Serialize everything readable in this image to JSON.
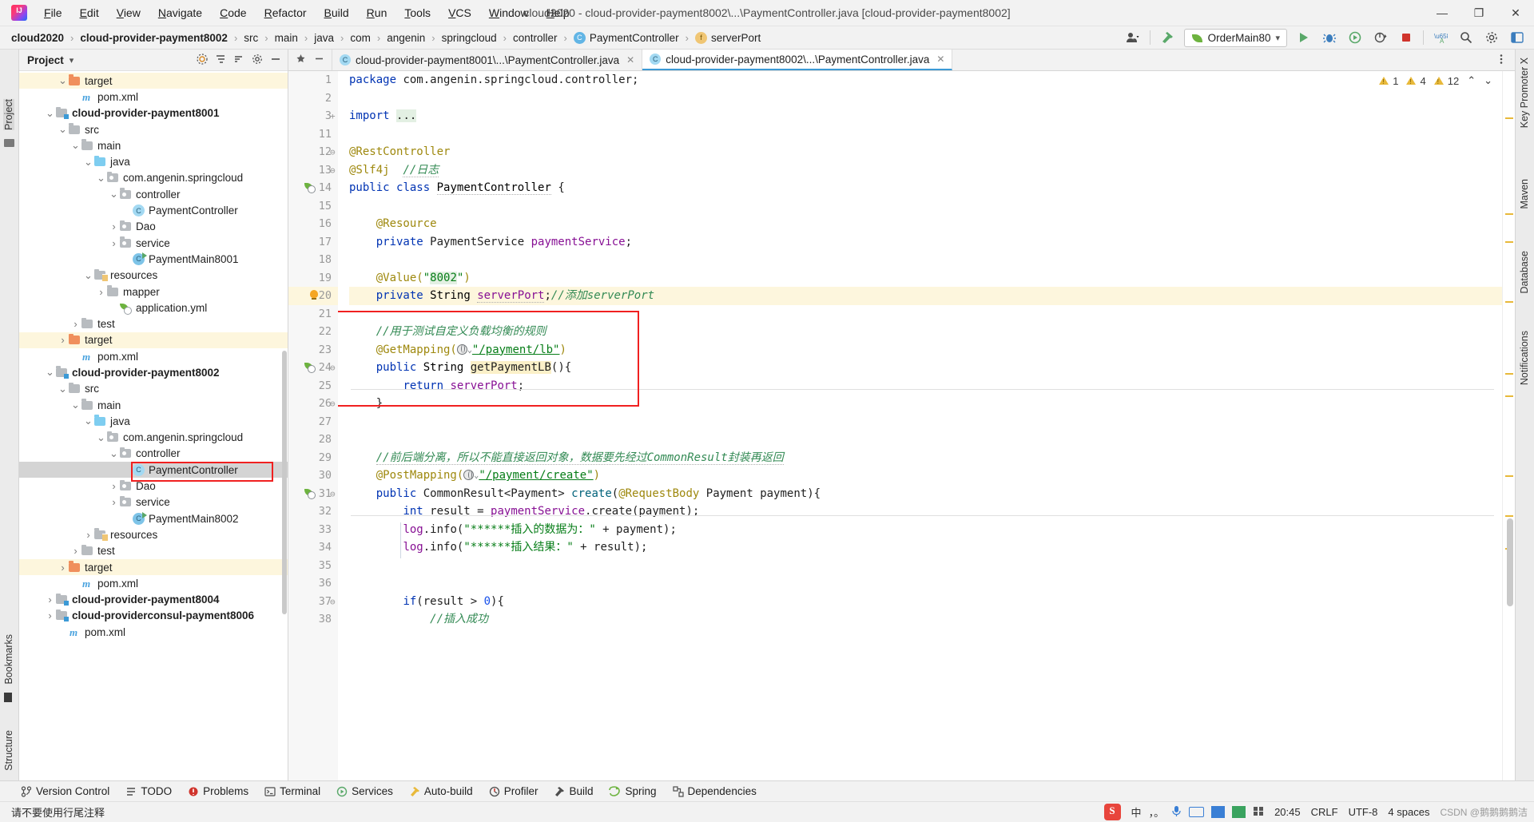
{
  "window": {
    "title": "cloud2020 - cloud-provider-payment8002\\...\\PaymentController.java [cloud-provider-payment8002]",
    "minimize": "—",
    "maximize": "❐",
    "close": "✕"
  },
  "menu": [
    "File",
    "Edit",
    "View",
    "Navigate",
    "Code",
    "Refactor",
    "Build",
    "Run",
    "Tools",
    "VCS",
    "Window",
    "Help"
  ],
  "breadcrumb": [
    {
      "label": "cloud2020",
      "bold": true,
      "icon": ""
    },
    {
      "label": "cloud-provider-payment8002",
      "bold": true,
      "icon": ""
    },
    {
      "label": "src",
      "bold": false,
      "icon": ""
    },
    {
      "label": "main",
      "bold": false,
      "icon": ""
    },
    {
      "label": "java",
      "bold": false,
      "icon": ""
    },
    {
      "label": "com",
      "bold": false,
      "icon": ""
    },
    {
      "label": "angenin",
      "bold": false,
      "icon": ""
    },
    {
      "label": "springcloud",
      "bold": false,
      "icon": ""
    },
    {
      "label": "controller",
      "bold": false,
      "icon": ""
    },
    {
      "label": "PaymentController",
      "bold": false,
      "icon": "class-icon",
      "glyph": "C"
    },
    {
      "label": "serverPort",
      "bold": false,
      "icon": "field-icon",
      "glyph": "f"
    }
  ],
  "toolbar": {
    "run_config": "OrderMain80",
    "run_config_dropdown": "▾",
    "icons": [
      "user-icon",
      "hammer-icon",
      "run-icon",
      "debug-icon",
      "run-coverage-icon",
      "profile-icon",
      "stop-icon",
      "translate-icon",
      "search-icon",
      "settings-icon",
      "layout-icon"
    ]
  },
  "project_panel": {
    "title": "Project",
    "dropdown": "▾",
    "header_buttons": [
      "locate-icon",
      "collapse-all-icon",
      "sort-icon",
      "settings-icon",
      "hide-icon"
    ],
    "tree": [
      {
        "label": "target",
        "indent": 3,
        "arrow": "v",
        "icon": "folder-orange",
        "bold": false,
        "highlight": "target",
        "partial": true
      },
      {
        "label": "pom.xml",
        "indent": 4,
        "arrow": "",
        "icon": "maven-icon",
        "bold": false
      },
      {
        "label": "cloud-provider-payment8001",
        "indent": 2,
        "arrow": "v",
        "icon": "module-icon",
        "bold": true
      },
      {
        "label": "src",
        "indent": 3,
        "arrow": "v",
        "icon": "folder",
        "bold": false
      },
      {
        "label": "main",
        "indent": 4,
        "arrow": "v",
        "icon": "folder",
        "bold": false
      },
      {
        "label": "java",
        "indent": 5,
        "arrow": "v",
        "icon": "folder-blue",
        "bold": false
      },
      {
        "label": "com.angenin.springcloud",
        "indent": 6,
        "arrow": "v",
        "icon": "package-icon",
        "bold": false
      },
      {
        "label": "controller",
        "indent": 7,
        "arrow": "v",
        "icon": "package-icon",
        "bold": false
      },
      {
        "label": "PaymentController",
        "indent": 8,
        "arrow": "",
        "icon": "class-icon",
        "bold": false
      },
      {
        "label": "Dao",
        "indent": 7,
        "arrow": ">",
        "icon": "package-icon",
        "bold": false
      },
      {
        "label": "service",
        "indent": 7,
        "arrow": ">",
        "icon": "package-icon",
        "bold": false
      },
      {
        "label": "PaymentMain8001",
        "indent": 8,
        "arrow": "",
        "icon": "class-run-icon",
        "bold": false
      },
      {
        "label": "resources",
        "indent": 5,
        "arrow": "v",
        "icon": "folder-resources",
        "bold": false
      },
      {
        "label": "mapper",
        "indent": 6,
        "arrow": ">",
        "icon": "folder",
        "bold": false
      },
      {
        "label": "application.yml",
        "indent": 7,
        "arrow": "",
        "icon": "spring-yml-icon",
        "bold": false
      },
      {
        "label": "test",
        "indent": 4,
        "arrow": ">",
        "icon": "folder",
        "bold": false
      },
      {
        "label": "target",
        "indent": 3,
        "arrow": ">",
        "icon": "folder-orange",
        "bold": false,
        "highlight": "target"
      },
      {
        "label": "pom.xml",
        "indent": 4,
        "arrow": "",
        "icon": "maven-icon",
        "bold": false
      },
      {
        "label": "cloud-provider-payment8002",
        "indent": 2,
        "arrow": "v",
        "icon": "module-icon",
        "bold": true
      },
      {
        "label": "src",
        "indent": 3,
        "arrow": "v",
        "icon": "folder",
        "bold": false
      },
      {
        "label": "main",
        "indent": 4,
        "arrow": "v",
        "icon": "folder",
        "bold": false
      },
      {
        "label": "java",
        "indent": 5,
        "arrow": "v",
        "icon": "folder-blue",
        "bold": false
      },
      {
        "label": "com.angenin.springcloud",
        "indent": 6,
        "arrow": "v",
        "icon": "package-icon",
        "bold": false
      },
      {
        "label": "controller",
        "indent": 7,
        "arrow": "v",
        "icon": "package-icon",
        "bold": false
      },
      {
        "label": "PaymentController",
        "indent": 8,
        "arrow": "",
        "icon": "class-icon",
        "bold": false,
        "selected": true,
        "boxed": true
      },
      {
        "label": "Dao",
        "indent": 7,
        "arrow": ">",
        "icon": "package-icon",
        "bold": false
      },
      {
        "label": "service",
        "indent": 7,
        "arrow": ">",
        "icon": "package-icon",
        "bold": false
      },
      {
        "label": "PaymentMain8002",
        "indent": 8,
        "arrow": "",
        "icon": "class-run-icon",
        "bold": false
      },
      {
        "label": "resources",
        "indent": 5,
        "arrow": ">",
        "icon": "folder-resources",
        "bold": false
      },
      {
        "label": "test",
        "indent": 4,
        "arrow": ">",
        "icon": "folder",
        "bold": false
      },
      {
        "label": "target",
        "indent": 3,
        "arrow": ">",
        "icon": "folder-orange",
        "bold": false,
        "highlight": "target"
      },
      {
        "label": "pom.xml",
        "indent": 4,
        "arrow": "",
        "icon": "maven-icon",
        "bold": false
      },
      {
        "label": "cloud-provider-payment8004",
        "indent": 2,
        "arrow": ">",
        "icon": "module-icon",
        "bold": true
      },
      {
        "label": "cloud-providerconsul-payment8006",
        "indent": 2,
        "arrow": ">",
        "icon": "module-icon",
        "bold": true
      },
      {
        "label": "pom.xml",
        "indent": 3,
        "arrow": "",
        "icon": "maven-icon",
        "bold": false
      }
    ]
  },
  "left_strip": [
    "Project",
    "Bookmarks",
    "Structure"
  ],
  "right_strip": [
    "Key Promoter X",
    "Maven",
    "Database",
    "Notifications"
  ],
  "tabs": [
    {
      "label": "cloud-provider-payment8001\\...\\PaymentController.java",
      "active": false,
      "glyph": "C",
      "close": "✕"
    },
    {
      "label": "cloud-provider-payment8002\\...\\PaymentController.java",
      "active": true,
      "glyph": "C",
      "close": "✕"
    }
  ],
  "inspection": {
    "warnings_typo": "1",
    "warnings": "4",
    "weak_warnings": "12",
    "up": "⌃",
    "down": "⌄"
  },
  "editor": {
    "lines": [
      {
        "n": "1",
        "html": "<span class='kw'>package</span> com.angenin.springcloud.controller;"
      },
      {
        "n": "2",
        "html": ""
      },
      {
        "n": "3",
        "html": "<span class='kw'>import</span> <span class='hl-g'>...</span>",
        "fold": "+"
      },
      {
        "n": "11",
        "html": ""
      },
      {
        "n": "12",
        "html": "<span class='ann'>@RestController</span>",
        "fold": "⊖"
      },
      {
        "n": "13",
        "html": "<span class='ann'>@Slf4j</span>  <span class='cmt-cn squig'>//日志</span>",
        "fold": "⊖"
      },
      {
        "n": "14",
        "html": "<span class='kw'>public</span> <span class='kw'>class</span> <span class='typ squig'>PaymentController</span> {",
        "gutter": "spring-run-icon"
      },
      {
        "n": "15",
        "html": ""
      },
      {
        "n": "16",
        "html": "    <span class='ann'>@Resource</span>"
      },
      {
        "n": "17",
        "html": "    <span class='kw'>private</span> PaymentService <span class='fld-v'>paymentService</span>;"
      },
      {
        "n": "18",
        "html": ""
      },
      {
        "n": "19",
        "html": "    <span class='ann'>@Value(</span><span class='str'>\"</span><span class='str hl-g'>8002</span><span class='str'>\"</span><span class='ann'>)</span>"
      },
      {
        "n": "20",
        "html": "    <span class='kw'>private</span> <span class='typ'>String</span> <span class='fld-v squig'>serverPort</span>;<span class='cmt-cn'>//添加serverPort</span>",
        "gutter": "bulb-icon",
        "hl": true
      },
      {
        "n": "21",
        "html": ""
      },
      {
        "n": "22",
        "html": "    <span class='cmt-cn'>//用于测试自定义负载均衡的规则</span>"
      },
      {
        "n": "23",
        "html": "    <span class='ann'>@GetMapping(</span><span class='globe-ph'></span><span class='str ulink'>\"/payment/lb\"</span><span class='ann'>)</span>"
      },
      {
        "n": "24",
        "html": "    <span class='kw'>public</span> <span class='typ'>String</span> <span class='hl-sym'>getPaymentLB</span>(){",
        "gutter": "spring-run-icon",
        "fold": "⊖"
      },
      {
        "n": "25",
        "html": "        <span class='kw'>return</span> <span class='fld-v'>serverPort</span>;"
      },
      {
        "n": "26",
        "html": "    }",
        "fold": "⊖"
      },
      {
        "n": "27",
        "html": ""
      },
      {
        "n": "28",
        "html": ""
      },
      {
        "n": "29",
        "html": "    <span class='cmt-cn squig'>//前后端分离，所以不能直接返回对象，数据要先经过CommonResult封装再返回</span>"
      },
      {
        "n": "30",
        "html": "    <span class='ann'>@PostMapping(</span><span class='globe-ph'></span><span class='str ulink'>\"/payment/create\"</span><span class='ann'>)</span>"
      },
      {
        "n": "31",
        "html": "    <span class='kw'>public</span> CommonResult&lt;Payment&gt; <span class='mth'>create</span>(<span class='ann'>@RequestBody</span> Payment payment){",
        "gutter": "spring-run-icon",
        "fold": "⊖"
      },
      {
        "n": "32",
        "html": "        <span class='kw'>int</span> result = <span class='fld-v'>paymentService</span>.create(payment);"
      },
      {
        "n": "33",
        "html": "        <span class='fld-v'>log</span>.info(<span class='str'>\"******插入的数据为：\"</span> + payment);"
      },
      {
        "n": "34",
        "html": "        <span class='fld-v'>log</span>.info(<span class='str'>\"******插入结果：\"</span> + result);"
      },
      {
        "n": "35",
        "html": ""
      },
      {
        "n": "36",
        "html": ""
      },
      {
        "n": "37",
        "html": "        <span class='kw'>if</span>(result &gt; <span class='num'>0</span>){",
        "fold": "⊖"
      },
      {
        "n": "38",
        "html": "            <span class='cmt-cn'>//插入成功</span>"
      }
    ]
  },
  "toolwindow_bar": [
    {
      "label": "Version Control",
      "icon": "branch-icon"
    },
    {
      "label": "TODO",
      "icon": "list-icon"
    },
    {
      "label": "Problems",
      "icon": "error-icon"
    },
    {
      "label": "Terminal",
      "icon": "terminal-icon"
    },
    {
      "label": "Services",
      "icon": "services-icon"
    },
    {
      "label": "Auto-build",
      "icon": "autobuild-icon"
    },
    {
      "label": "Profiler",
      "icon": "profiler-icon"
    },
    {
      "label": "Build",
      "icon": "build-icon"
    },
    {
      "label": "Spring",
      "icon": "spring-icon"
    },
    {
      "label": "Dependencies",
      "icon": "dependencies-icon"
    }
  ],
  "status": {
    "message": "请不要使用行尾注释",
    "time": "20:45",
    "line_sep": "CRLF",
    "encoding": "UTF-8",
    "indent": "4 spaces",
    "ime_lang": "中",
    "ime_punct": "，。",
    "watermark": "CSDN @鹅鹅鹅鹅洁"
  },
  "colors": {
    "accent": "#3c9ad6",
    "spring_green": "#6db33f",
    "highlight_box": "#f02020",
    "string": "#067d17",
    "keyword": "#0033b3",
    "annotation": "#9e880d",
    "comment_cn": "#338a54"
  }
}
